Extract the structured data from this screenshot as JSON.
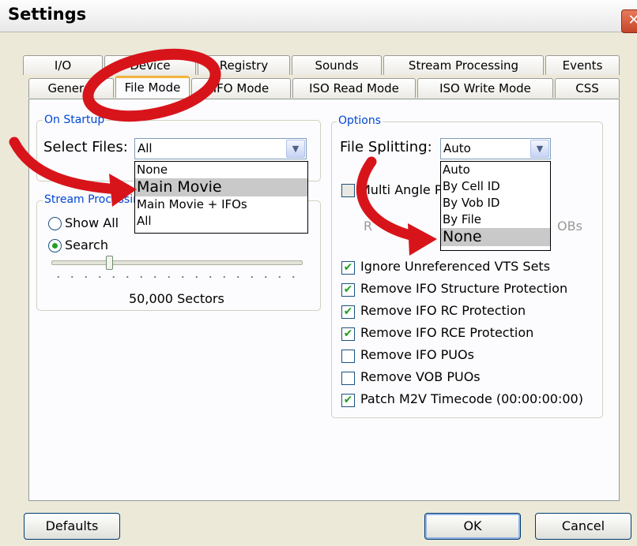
{
  "window": {
    "title": "Settings",
    "close_glyph": "✕"
  },
  "tabs_row1": [
    {
      "label": "I/O"
    },
    {
      "label": "Device"
    },
    {
      "label": "Registry"
    },
    {
      "label": "Sounds"
    },
    {
      "label": "Stream Processing"
    },
    {
      "label": "Events"
    }
  ],
  "tabs_row2": [
    {
      "label": "General"
    },
    {
      "label": "File Mode"
    },
    {
      "label": "IFO Mode"
    },
    {
      "label": "ISO Read Mode"
    },
    {
      "label": "ISO Write Mode"
    },
    {
      "label": "CSS"
    }
  ],
  "on_startup": {
    "group_label": "On Startup",
    "select_files_label": "Select Files:",
    "select_files_value": "All",
    "options": [
      "None",
      "Main Movie",
      "Main Movie + IFOs",
      "All"
    ],
    "highlighted": "Main Movie"
  },
  "stream_processing": {
    "group_label": "Stream Processing",
    "show_all_label": "Show All",
    "search_label": "Search",
    "sectors_label": "50,000 Sectors",
    "slider_value": 0.23,
    "selected": "Search"
  },
  "options": {
    "group_label": "Options",
    "file_splitting_label": "File Splitting:",
    "file_splitting_value": "Auto",
    "split_options": [
      "Auto",
      "By Cell ID",
      "By Vob ID",
      "By File",
      "None"
    ],
    "highlighted": "None",
    "multi_angle_label": "Multi Angle P",
    "hidden_row_left": "R",
    "hidden_row_right": "OBs",
    "checkboxes": [
      {
        "label": "Ignore Unreferenced VTS Sets",
        "checked": true
      },
      {
        "label": "Remove IFO Structure Protection",
        "checked": true
      },
      {
        "label": "Remove IFO RC Protection",
        "checked": true
      },
      {
        "label": "Remove IFO RCE Protection",
        "checked": true
      },
      {
        "label": "Remove IFO PUOs",
        "checked": false
      },
      {
        "label": "Remove VOB PUOs",
        "checked": false
      },
      {
        "label": "Patch M2V Timecode (00:00:00:00)",
        "checked": true
      }
    ]
  },
  "buttons": {
    "defaults": "Defaults",
    "ok": "OK",
    "cancel": "Cancel"
  },
  "icons": {
    "check": "✔",
    "dropdown": "▼"
  },
  "colors": {
    "annotation_red": "#d8141b",
    "group_label_blue": "#0046d5",
    "check_green": "#21a121"
  }
}
